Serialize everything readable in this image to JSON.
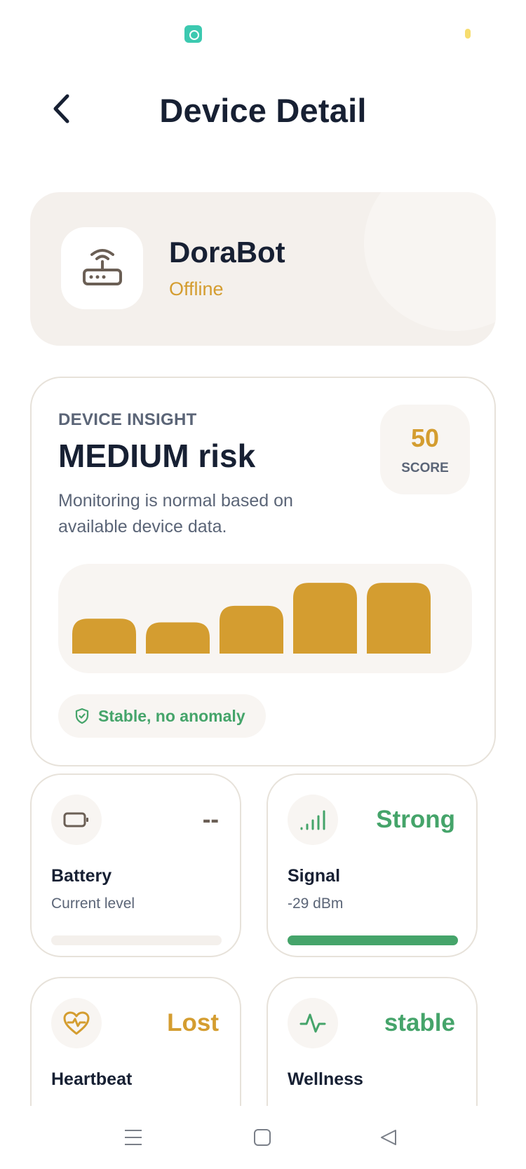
{
  "header": {
    "title": "Device Detail"
  },
  "device": {
    "name": "DoraBot",
    "status": "Offline",
    "icon": "router-icon"
  },
  "insight": {
    "label": "DEVICE INSIGHT",
    "risk": "MEDIUM risk",
    "description": "Monitoring is normal based on available device data.",
    "score": "50",
    "score_label": "SCORE",
    "status_pill": "Stable, no anomaly",
    "chart_data": {
      "type": "bar",
      "values": [
        0.38,
        0.34,
        0.52,
        0.77,
        0.77
      ]
    }
  },
  "metrics": {
    "battery": {
      "title": "Battery",
      "subtitle": "Current level",
      "value": "--",
      "level": 0
    },
    "signal": {
      "title": "Signal",
      "subtitle": "-29 dBm",
      "value": "Strong",
      "level": 1.0
    },
    "heartbeat": {
      "title": "Heartbeat",
      "value": "Lost"
    },
    "wellness": {
      "title": "Wellness",
      "value": "stable"
    }
  },
  "colors": {
    "accent": "#d49d30",
    "success": "#45a46a",
    "text": "#172033",
    "muted": "#5b6577",
    "surface": "#f4f0ec"
  }
}
